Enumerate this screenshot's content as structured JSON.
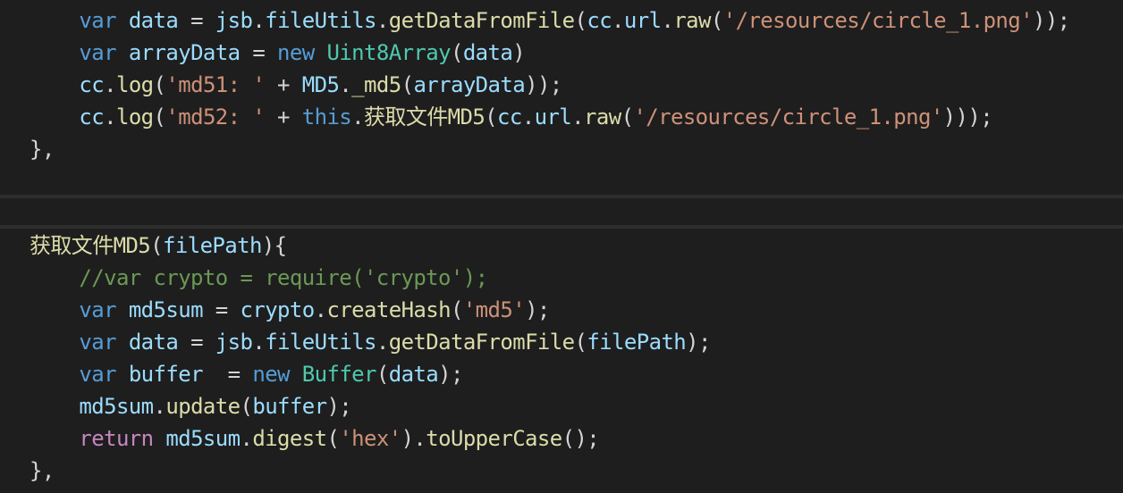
{
  "colors": {
    "background": "#1e1e1e",
    "separator": "#2d2d2d",
    "keyword": "#569cd6",
    "control": "#c586c0",
    "type": "#4ec9b0",
    "function": "#dcdcaa",
    "string": "#ce9178",
    "comment": "#6a9955",
    "variable": "#9cdcfe",
    "plain": "#d4d4d4"
  },
  "lines": [
    {
      "tokens": [
        {
          "t": "    ",
          "c": "pl"
        },
        {
          "t": "var",
          "c": "kw"
        },
        {
          "t": " ",
          "c": "pl"
        },
        {
          "t": "data",
          "c": "vr"
        },
        {
          "t": " = ",
          "c": "pl"
        },
        {
          "t": "jsb",
          "c": "vr"
        },
        {
          "t": ".",
          "c": "pl"
        },
        {
          "t": "fileUtils",
          "c": "vr"
        },
        {
          "t": ".",
          "c": "pl"
        },
        {
          "t": "getDataFromFile",
          "c": "fn"
        },
        {
          "t": "(",
          "c": "pl"
        },
        {
          "t": "cc",
          "c": "vr"
        },
        {
          "t": ".",
          "c": "pl"
        },
        {
          "t": "url",
          "c": "vr"
        },
        {
          "t": ".",
          "c": "pl"
        },
        {
          "t": "raw",
          "c": "fn"
        },
        {
          "t": "(",
          "c": "pl"
        },
        {
          "t": "'/resources/circle_1.png'",
          "c": "str"
        },
        {
          "t": "));",
          "c": "pl"
        }
      ]
    },
    {
      "tokens": [
        {
          "t": "    ",
          "c": "pl"
        },
        {
          "t": "var",
          "c": "kw"
        },
        {
          "t": " ",
          "c": "pl"
        },
        {
          "t": "arrayData",
          "c": "vr"
        },
        {
          "t": " = ",
          "c": "pl"
        },
        {
          "t": "new",
          "c": "kw"
        },
        {
          "t": " ",
          "c": "pl"
        },
        {
          "t": "Uint8Array",
          "c": "ty"
        },
        {
          "t": "(",
          "c": "pl"
        },
        {
          "t": "data",
          "c": "vr"
        },
        {
          "t": ")",
          "c": "pl"
        }
      ]
    },
    {
      "tokens": [
        {
          "t": "    ",
          "c": "pl"
        },
        {
          "t": "cc",
          "c": "vr"
        },
        {
          "t": ".",
          "c": "pl"
        },
        {
          "t": "log",
          "c": "fn"
        },
        {
          "t": "(",
          "c": "pl"
        },
        {
          "t": "'md51: '",
          "c": "str"
        },
        {
          "t": " + ",
          "c": "pl"
        },
        {
          "t": "MD5",
          "c": "vr"
        },
        {
          "t": ".",
          "c": "pl"
        },
        {
          "t": "_md5",
          "c": "fn"
        },
        {
          "t": "(",
          "c": "pl"
        },
        {
          "t": "arrayData",
          "c": "vr"
        },
        {
          "t": "));",
          "c": "pl"
        }
      ]
    },
    {
      "tokens": [
        {
          "t": "    ",
          "c": "pl"
        },
        {
          "t": "cc",
          "c": "vr"
        },
        {
          "t": ".",
          "c": "pl"
        },
        {
          "t": "log",
          "c": "fn"
        },
        {
          "t": "(",
          "c": "pl"
        },
        {
          "t": "'md52: '",
          "c": "str"
        },
        {
          "t": " + ",
          "c": "pl"
        },
        {
          "t": "this",
          "c": "kw"
        },
        {
          "t": ".",
          "c": "pl"
        },
        {
          "t": "获取文件MD5",
          "c": "fn"
        },
        {
          "t": "(",
          "c": "pl"
        },
        {
          "t": "cc",
          "c": "vr"
        },
        {
          "t": ".",
          "c": "pl"
        },
        {
          "t": "url",
          "c": "vr"
        },
        {
          "t": ".",
          "c": "pl"
        },
        {
          "t": "raw",
          "c": "fn"
        },
        {
          "t": "(",
          "c": "pl"
        },
        {
          "t": "'/resources/circle_1.png'",
          "c": "str"
        },
        {
          "t": ")));",
          "c": "pl"
        }
      ]
    },
    {
      "tokens": [
        {
          "t": "},",
          "c": "pl"
        }
      ]
    },
    {
      "tokens": [
        {
          "t": "获取文件MD5",
          "c": "fn"
        },
        {
          "t": "(",
          "c": "pl"
        },
        {
          "t": "filePath",
          "c": "vr"
        },
        {
          "t": "){",
          "c": "pl"
        }
      ]
    },
    {
      "tokens": [
        {
          "t": "    ",
          "c": "pl"
        },
        {
          "t": "//var crypto = require('crypto');",
          "c": "cm"
        }
      ]
    },
    {
      "tokens": [
        {
          "t": "    ",
          "c": "pl"
        },
        {
          "t": "var",
          "c": "kw"
        },
        {
          "t": " ",
          "c": "pl"
        },
        {
          "t": "md5sum",
          "c": "vr"
        },
        {
          "t": " = ",
          "c": "pl"
        },
        {
          "t": "crypto",
          "c": "vr"
        },
        {
          "t": ".",
          "c": "pl"
        },
        {
          "t": "createHash",
          "c": "fn"
        },
        {
          "t": "(",
          "c": "pl"
        },
        {
          "t": "'md5'",
          "c": "str"
        },
        {
          "t": ");",
          "c": "pl"
        }
      ]
    },
    {
      "tokens": [
        {
          "t": "    ",
          "c": "pl"
        },
        {
          "t": "var",
          "c": "kw"
        },
        {
          "t": " ",
          "c": "pl"
        },
        {
          "t": "data",
          "c": "vr"
        },
        {
          "t": " = ",
          "c": "pl"
        },
        {
          "t": "jsb",
          "c": "vr"
        },
        {
          "t": ".",
          "c": "pl"
        },
        {
          "t": "fileUtils",
          "c": "vr"
        },
        {
          "t": ".",
          "c": "pl"
        },
        {
          "t": "getDataFromFile",
          "c": "fn"
        },
        {
          "t": "(",
          "c": "pl"
        },
        {
          "t": "filePath",
          "c": "vr"
        },
        {
          "t": ");",
          "c": "pl"
        }
      ]
    },
    {
      "tokens": [
        {
          "t": "    ",
          "c": "pl"
        },
        {
          "t": "var",
          "c": "kw"
        },
        {
          "t": " ",
          "c": "pl"
        },
        {
          "t": "buffer",
          "c": "vr"
        },
        {
          "t": "  = ",
          "c": "pl"
        },
        {
          "t": "new",
          "c": "kw"
        },
        {
          "t": " ",
          "c": "pl"
        },
        {
          "t": "Buffer",
          "c": "ty"
        },
        {
          "t": "(",
          "c": "pl"
        },
        {
          "t": "data",
          "c": "vr"
        },
        {
          "t": ");",
          "c": "pl"
        }
      ]
    },
    {
      "tokens": [
        {
          "t": "    ",
          "c": "pl"
        },
        {
          "t": "md5sum",
          "c": "vr"
        },
        {
          "t": ".",
          "c": "pl"
        },
        {
          "t": "update",
          "c": "fn"
        },
        {
          "t": "(",
          "c": "pl"
        },
        {
          "t": "buffer",
          "c": "vr"
        },
        {
          "t": ");",
          "c": "pl"
        }
      ]
    },
    {
      "tokens": [
        {
          "t": "    ",
          "c": "pl"
        },
        {
          "t": "return",
          "c": "ctl"
        },
        {
          "t": " ",
          "c": "pl"
        },
        {
          "t": "md5sum",
          "c": "vr"
        },
        {
          "t": ".",
          "c": "pl"
        },
        {
          "t": "digest",
          "c": "fn"
        },
        {
          "t": "(",
          "c": "pl"
        },
        {
          "t": "'hex'",
          "c": "str"
        },
        {
          "t": ").",
          "c": "pl"
        },
        {
          "t": "toUpperCase",
          "c": "fn"
        },
        {
          "t": "();",
          "c": "pl"
        }
      ]
    },
    {
      "tokens": [
        {
          "t": "},",
          "c": "pl"
        }
      ]
    }
  ]
}
